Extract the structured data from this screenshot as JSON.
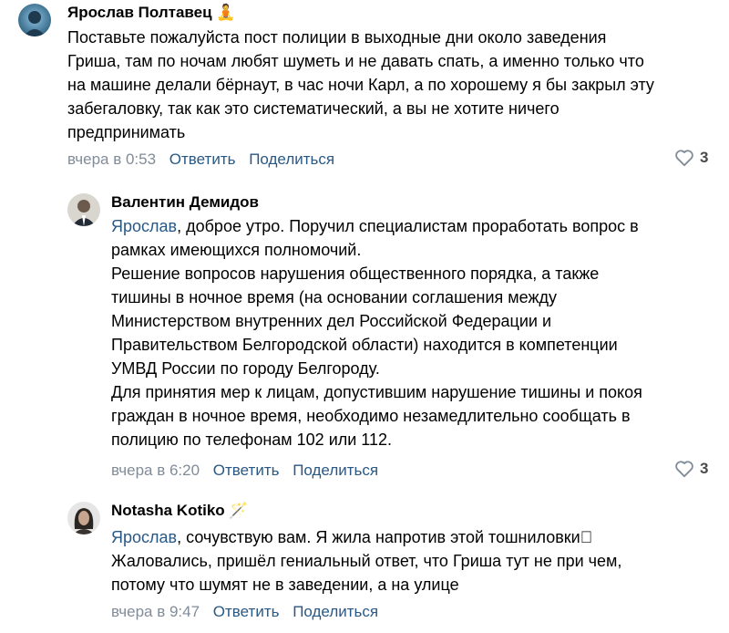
{
  "comments": [
    {
      "author": "Ярослав Полтавец",
      "author_emoji": "🧘",
      "lines": [
        "Поставьте пожалуйста пост полиции в выходные дни около заведения",
        "Гриша, там по ночам любят шуметь и не давать спать, а именно только что",
        "на машине делали бёрнаут, в час ночи Карл, а по хорошему я бы закрыл эту",
        "забегаловку, так как это систематический, а вы не хотите ничего",
        "предпринимать"
      ],
      "time": "вчера в 0:53",
      "reply_label": "Ответить",
      "share_label": "Поделиться",
      "likes": "3"
    },
    {
      "author": "Валентин Демидов",
      "mention": "Ярослав",
      "first_line_rest": ", доброе утро. Поручил специалистам проработать вопрос в",
      "lines": [
        "рамках имеющихся полномочий.",
        "Решение вопросов нарушения общественного порядка, а также",
        "тишины в ночное время (на основании соглашения между",
        "Министерством внутренних дел Российской Федерации и",
        "Правительством Белгородской области) находится в компетенции",
        "УМВД России по городу Белгороду.",
        "Для принятия мер к лицам, допустившим нарушение тишины и покоя",
        "граждан в ночное время, необходимо незамедлительно сообщать в",
        "полицию по телефонам 102 или 112."
      ],
      "time": "вчера в 6:20",
      "reply_label": "Ответить",
      "share_label": "Поделиться",
      "likes": "3"
    },
    {
      "author": "Notasha Kotiko",
      "author_emoji": "🪄",
      "mention": "Ярослав",
      "first_line_rest": ", сочувствую вам. Я жила напротив этой тошниловки⃣",
      "lines": [
        "Жаловались, пришёл гениальный ответ, что Гриша тут не при чем,",
        "потому что шумят не в заведении, а на улице"
      ],
      "time": "вчера в 9:47",
      "reply_label": "Ответить",
      "share_label": "Поделиться"
    }
  ],
  "colors": {
    "link": "#2a5885",
    "meta": "#818c99",
    "text": "#000000"
  }
}
